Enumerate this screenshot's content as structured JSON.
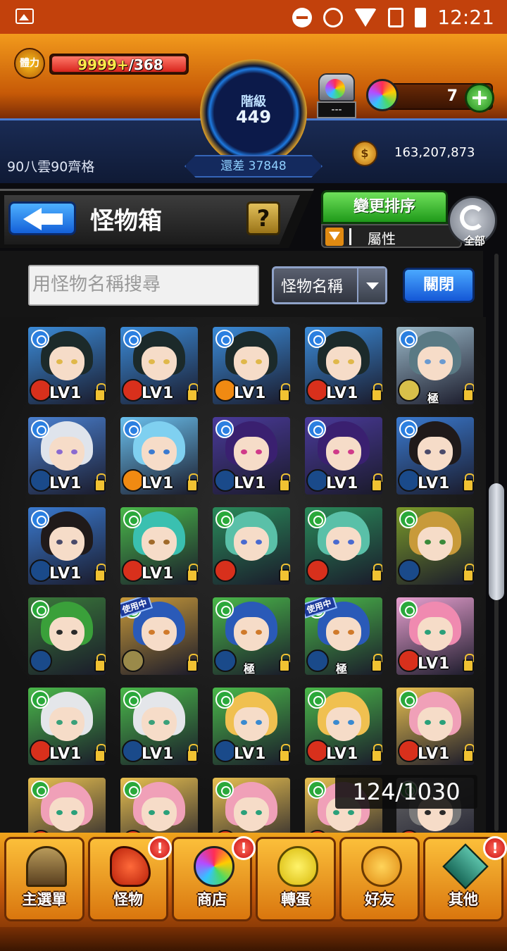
{
  "status_bar": {
    "time": "12:21"
  },
  "hud": {
    "stamina_label": "體力",
    "stamina_current": "9999+",
    "stamina_max": "/368",
    "rank_label": "階級",
    "rank_value": "449",
    "exp_remaining": "還差 37848",
    "orb_box_label": "---",
    "orb_count": "7",
    "orb_plus": "+",
    "gold": "163,207,873",
    "player_name": "90八雲90齊格"
  },
  "title_bar": {
    "title": "怪物箱",
    "help": "?"
  },
  "sort": {
    "change_sort": "變更排序",
    "filter_label": "屬性",
    "all_label": "全部"
  },
  "search": {
    "placeholder": "用怪物名稱搜尋",
    "select_value": "怪物名稱",
    "close": "關閉"
  },
  "monsters": [
    {
      "level": "LV1",
      "element": "water",
      "elem_color": "#2b7fe0",
      "badge_color": "#d8301c",
      "hair": "#1c2a2a",
      "eye": "#e0b84a",
      "bg": "#3b8bd8"
    },
    {
      "level": "LV1",
      "element": "water",
      "elem_color": "#2b7fe0",
      "badge_color": "#d8301c",
      "hair": "#1c2a2a",
      "eye": "#e0b84a",
      "bg": "#3b8bd8"
    },
    {
      "level": "LV1",
      "element": "water",
      "elem_color": "#2b7fe0",
      "badge_color": "#f08a12",
      "hair": "#1c2a2a",
      "eye": "#e0b84a",
      "bg": "#3b8bd8"
    },
    {
      "level": "LV1",
      "element": "water",
      "elem_color": "#2b7fe0",
      "badge_color": "#d8301c",
      "hair": "#1c2a2a",
      "eye": "#e0b84a",
      "bg": "#3b8bd8"
    },
    {
      "level": "",
      "element": "water",
      "elem_color": "#2b7fe0",
      "badge_color": "#d8c04a",
      "hair": "#5a7a84",
      "eye": "#6a9ad0",
      "bg": "#9ab8c8",
      "tag": "極"
    },
    {
      "level": "LV1",
      "element": "water",
      "elem_color": "#2b7fe0",
      "badge_color": "#1a4a8a",
      "hair": "#dfe4ec",
      "eye": "#8a6ad0",
      "bg": "#4a80d0"
    },
    {
      "level": "LV1",
      "element": "water",
      "elem_color": "#2b7fe0",
      "badge_color": "#f08a12",
      "hair": "#7fd0f0",
      "eye": "#3a7ad0",
      "bg": "#6ac0ee"
    },
    {
      "level": "LV1",
      "element": "water",
      "elem_color": "#2b7fe0",
      "badge_color": "#1a4a8a",
      "hair": "#3a2070",
      "eye": "#d03a8a",
      "bg": "#4a3a9a"
    },
    {
      "level": "LV1",
      "element": "water",
      "elem_color": "#2b7fe0",
      "badge_color": "#1a4a8a",
      "hair": "#3a2070",
      "eye": "#d03a8a",
      "bg": "#4a3a9a"
    },
    {
      "level": "LV1",
      "element": "water",
      "elem_color": "#2b7fe0",
      "badge_color": "#1a4a8a",
      "hair": "#201a1a",
      "eye": "#4a4a6a",
      "bg": "#3a7ad0"
    },
    {
      "level": "LV1",
      "element": "water",
      "elem_color": "#2b7fe0",
      "badge_color": "#1a4a8a",
      "hair": "#201a1a",
      "eye": "#4a4a6a",
      "bg": "#3a7ad0"
    },
    {
      "level": "LV1",
      "element": "wood",
      "elem_color": "#2aa83a",
      "badge_color": "#d8301c",
      "hair": "#3ac0b0",
      "eye": "#a06a2a",
      "bg": "#4ab84a"
    },
    {
      "level": "",
      "element": "wood",
      "elem_color": "#2aa83a",
      "badge_color": "#d8301c",
      "hair": "#5ac0a8",
      "eye": "#4a6ad0",
      "bg": "#2a8a5a"
    },
    {
      "level": "",
      "element": "wood",
      "elem_color": "#2aa83a",
      "badge_color": "#d8301c",
      "hair": "#5ac0a8",
      "eye": "#4a6ad0",
      "bg": "#2a8a5a"
    },
    {
      "level": "",
      "element": "wood",
      "elem_color": "#2aa83a",
      "badge_color": "#1a4a8a",
      "hair": "#c89a3a",
      "eye": "#3a8a3a",
      "bg": "#7a9a2a"
    },
    {
      "level": "",
      "element": "wood",
      "elem_color": "#2aa83a",
      "badge_color": "#1a4a8a",
      "hair": "#3aa03a",
      "eye": "#2a2a2a",
      "bg": "#3a7a3a"
    },
    {
      "level": "",
      "element": "wood",
      "elem_color": "#2aa83a",
      "badge_color": "#9a8a4a",
      "hair": "#2a5ab8",
      "eye": "#d07a2a",
      "bg": "#c89a3a",
      "in_use": "使用中"
    },
    {
      "level": "",
      "element": "wood",
      "elem_color": "#2aa83a",
      "badge_color": "#1a4a8a",
      "hair": "#2a5ab8",
      "eye": "#d07a2a",
      "bg": "#4ab84a",
      "tag": "極"
    },
    {
      "level": "",
      "element": "wood",
      "elem_color": "#2aa83a",
      "badge_color": "#1a4a8a",
      "hair": "#2a5ab8",
      "eye": "#d07a2a",
      "bg": "#4ab84a",
      "tag": "極",
      "in_use": "使用中"
    },
    {
      "level": "LV1",
      "element": "wood",
      "elem_color": "#2aa83a",
      "badge_color": "#d8301c",
      "hair": "#f08ab0",
      "eye": "#2aa07a",
      "bg": "#e8a0d0"
    },
    {
      "level": "LV1",
      "element": "wood",
      "elem_color": "#2aa83a",
      "badge_color": "#d8301c",
      "hair": "#e4e6ea",
      "eye": "#3aa07a",
      "bg": "#4ab84a"
    },
    {
      "level": "LV1",
      "element": "wood",
      "elem_color": "#2aa83a",
      "badge_color": "#1a4a8a",
      "hair": "#e4e6ea",
      "eye": "#3aa07a",
      "bg": "#4ab84a"
    },
    {
      "level": "LV1",
      "element": "wood",
      "elem_color": "#2aa83a",
      "badge_color": "#1a4a8a",
      "hair": "#f0c050",
      "eye": "#3a8ad0",
      "bg": "#4ab84a"
    },
    {
      "level": "LV1",
      "element": "wood",
      "elem_color": "#2aa83a",
      "badge_color": "#d8301c",
      "hair": "#f0c050",
      "eye": "#3a8ad0",
      "bg": "#4ab84a"
    },
    {
      "level": "LV1",
      "element": "wood",
      "elem_color": "#2aa83a",
      "badge_color": "#d8301c",
      "hair": "#f0a0b8",
      "eye": "#2aa07a",
      "bg": "#e8c050"
    },
    {
      "level": "",
      "element": "wood",
      "elem_color": "#2aa83a",
      "badge_color": "#d8301c",
      "hair": "#f0a0b8",
      "eye": "#2aa07a",
      "bg": "#e8c050"
    },
    {
      "level": "",
      "element": "wood",
      "elem_color": "#2aa83a",
      "badge_color": "#d8301c",
      "hair": "#f0a0b8",
      "eye": "#2aa07a",
      "bg": "#e8c050"
    },
    {
      "level": "",
      "element": "wood",
      "elem_color": "#2aa83a",
      "badge_color": "#d8301c",
      "hair": "#f0a0b8",
      "eye": "#2aa07a",
      "bg": "#e8c050"
    },
    {
      "level": "",
      "element": "wood",
      "elem_color": "#2aa83a",
      "badge_color": "#d8301c",
      "hair": "#f0a0b8",
      "eye": "#2aa07a",
      "bg": "#e8c050"
    },
    {
      "level": "",
      "element": "wood",
      "elem_color": "#2aa83a",
      "badge_color": "#d8301c",
      "hair": "#7a7a7a",
      "eye": "#2a2a2a",
      "bg": "#6a6a6a"
    }
  ],
  "box_count": "124/1030",
  "nav": [
    {
      "label": "主選單",
      "icon": "gate-icon",
      "alert": ""
    },
    {
      "label": "怪物",
      "icon": "monster-icon",
      "alert": "!"
    },
    {
      "label": "商店",
      "icon": "orb-icon",
      "alert": "!"
    },
    {
      "label": "轉蛋",
      "icon": "egg-icon",
      "alert": ""
    },
    {
      "label": "好友",
      "icon": "friends-icon",
      "alert": ""
    },
    {
      "label": "其他",
      "icon": "other-icon",
      "alert": "!"
    }
  ]
}
